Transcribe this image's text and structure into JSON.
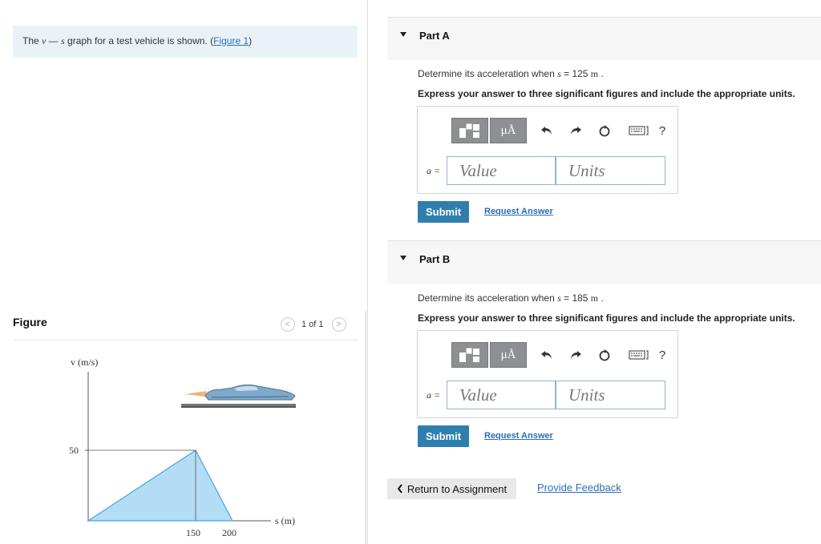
{
  "prompt": {
    "text_pre": "The ",
    "var_v": "v",
    "dash": " — ",
    "var_s": "s",
    "text_post": " graph for a test vehicle is shown. (",
    "figure_link": "Figure 1",
    "close_paren": ")"
  },
  "figure": {
    "title": "Figure",
    "pager": {
      "prev": "<",
      "count": "1 of 1",
      "next": ">"
    },
    "graph": {
      "y_axis_label": "v (m/s)",
      "x_axis_label": "s (m)",
      "y_tick": "50",
      "x_ticks": [
        "150",
        "200"
      ],
      "fill_color": "#b3dcf5",
      "line_color": "#45a6e0"
    }
  },
  "parts": [
    {
      "title": "Part A",
      "question_pre": "Determine its acceleration when ",
      "question_var": "s",
      "question_post": " = 125 ",
      "question_unit": "m",
      "question_end": " .",
      "instruction": "Express your answer to three significant figures and include the appropriate units.",
      "var_label": "a =",
      "value_placeholder": "Value",
      "units_placeholder": "Units",
      "submit": "Submit",
      "request": "Request Answer"
    },
    {
      "title": "Part B",
      "question_pre": "Determine its acceleration when ",
      "question_var": "s",
      "question_post": " = 185 ",
      "question_unit": "m",
      "question_end": " .",
      "instruction": "Express your answer to three significant figures and include the appropriate units.",
      "var_label": "a =",
      "value_placeholder": "Value",
      "units_placeholder": "Units",
      "submit": "Submit",
      "request": "Request Answer"
    }
  ],
  "toolbar": {
    "mu_a": "μÅ",
    "help": "?"
  },
  "footer": {
    "return": "Return to Assignment",
    "feedback": "Provide Feedback"
  },
  "colors": {
    "accent": "#2f7fae",
    "link": "#2a6ebb",
    "prompt_bg": "#e9f3f7"
  }
}
